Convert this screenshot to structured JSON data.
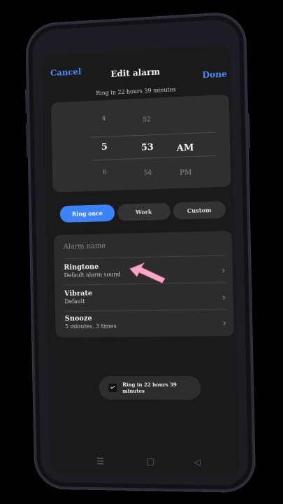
{
  "header": {
    "cancel": "Cancel",
    "title": "Edit alarm",
    "done": "Done",
    "subtitle": "Ring in 22 hours 39 minutes"
  },
  "picker": {
    "hour": {
      "prev": "4",
      "selected": "5",
      "next": "6"
    },
    "minute": {
      "prev": "52",
      "selected": "53",
      "next": "54"
    },
    "ampm": {
      "selected": "AM",
      "next": "PM"
    }
  },
  "repeat": {
    "options": [
      "Ring once",
      "Work",
      "Custom"
    ],
    "selected": "Ring once"
  },
  "settings": {
    "alarm_name_placeholder": "Alarm name",
    "ringtone": {
      "title": "Ringtone",
      "value": "Default alarm sound"
    },
    "vibrate": {
      "title": "Vibrate",
      "value": "Default"
    },
    "snooze": {
      "title": "Snooze",
      "value": "5 minutes, 3 times"
    }
  },
  "toast": {
    "text": "Ring in 22 hours 39 minutes"
  },
  "colors": {
    "accent": "#3b83f6",
    "link": "#4a8df7",
    "background": "#1a1a1a",
    "card": "#2c2c2c",
    "arrow": "#f7a8c8"
  },
  "icons": [
    "chevron-right-icon",
    "alarm-icon",
    "menu-icon",
    "home-icon",
    "back-icon",
    "pointer-arrow-icon"
  ]
}
